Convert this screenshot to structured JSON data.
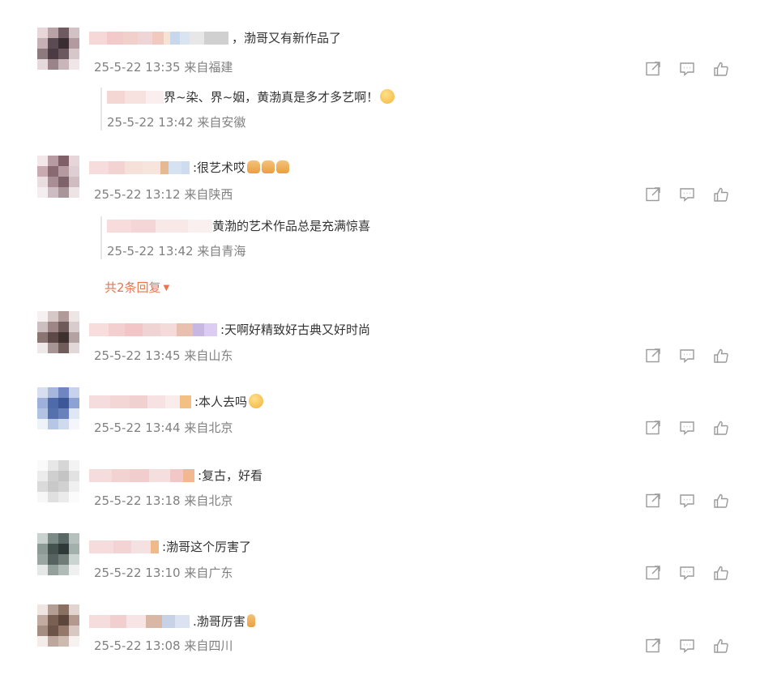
{
  "comments": [
    {
      "nick_colors": [
        "#f6d8d8",
        "#f4c9c9",
        "#f1d0cc",
        "#efd5d5",
        "#f2c9bf",
        "#f7e3d3",
        "#c9d7ec",
        "#d9e4f3",
        "#e7e7e7",
        "#d0d0d0"
      ],
      "text": "，渤哥又有新作品了",
      "time": "25-5-22 13:35",
      "location": "来自福建",
      "avatar": [
        "#e9d6d9",
        "#b8a2a6",
        "#6e5a60",
        "#d2c2c5",
        "#c7b0b5",
        "#5b4a52",
        "#3a2e33",
        "#b29aa0",
        "#8d7a7f",
        "#4a3c42",
        "#6b585e",
        "#d7c6ca",
        "#e5d9dc",
        "#9a8489",
        "#c9b6bb",
        "#f0e6e8"
      ],
      "reply": {
        "nick_colors": [
          "#f4d6d3",
          "#f7e2df",
          "#fbeeee"
        ],
        "text": "界~染、界~姻，黄渤真是多才多艺啊！",
        "emoji_color": "#f4b63c",
        "time": "25-5-22 13:42",
        "location": "来自安徽"
      }
    },
    {
      "nick_colors": [
        "#f6dcdc",
        "#f3d2d2",
        "#f5e0da",
        "#f7e5dd",
        "#e7b990",
        "#d6e2f1",
        "#cddcf0"
      ],
      "text": ":很艺术哎",
      "time": "25-5-22 13:12",
      "location": "来自陕西",
      "avatar": [
        "#f3e7ea",
        "#b89aa2",
        "#7f6068",
        "#e6d6da",
        "#c9aab1",
        "#8a6a72",
        "#b69aa1",
        "#ddcfd3",
        "#e9dde0",
        "#a98e95",
        "#7d6269",
        "#d0bcc1",
        "#f5eef0",
        "#cdbcc1",
        "#a9969b",
        "#eee4e6"
      ],
      "reply": {
        "nick_colors": [
          "#f8dcdc",
          "#f5d6d6",
          "#f9e8e8",
          "#fbf0f0"
        ],
        "text": "黄渤的艺术作品总是充满惊喜",
        "time": "25-5-22 13:42",
        "location": "来自青海"
      },
      "more_label": "共2条回复"
    },
    {
      "nick_colors": [
        "#f7dedd",
        "#f4cfcf",
        "#f2c6c6",
        "#f0d3d3",
        "#f5dada",
        "#e9c0b0",
        "#c8b6e3",
        "#dccbf3"
      ],
      "text": ":天啊好精致好古典又好时尚",
      "time": "25-5-22 13:45",
      "location": "来自山东",
      "avatar": [
        "#f6f0f0",
        "#d7c8c8",
        "#b09a9a",
        "#eee5e5",
        "#cdbfbf",
        "#9e8686",
        "#6f5a5a",
        "#d9cccc",
        "#8b7474",
        "#5e4949",
        "#3f3030",
        "#b4a2a2",
        "#efe8e8",
        "#a79494",
        "#715c5c",
        "#e3d8d8"
      ]
    },
    {
      "nick_colors": [
        "#f6dddd",
        "#f3d6d6",
        "#f1d0d0",
        "#f6e2e2",
        "#fbecec",
        "#f2c083"
      ],
      "text": ":本人去吗",
      "emoji_color": "#f3b23b",
      "time": "25-5-22 13:44",
      "location": "来自北京",
      "avatar": [
        "#d7def0",
        "#a7b6dc",
        "#6f86c0",
        "#c7d2ec",
        "#9cb0da",
        "#4f6aa8",
        "#3c5696",
        "#8ca2d2",
        "#b2c2e3",
        "#5470ad",
        "#6a82bc",
        "#dfe6f4",
        "#eef2f9",
        "#b8c6e6",
        "#d0daef",
        "#f4f6fb"
      ]
    },
    {
      "nick_colors": [
        "#f6dddd",
        "#f3d2d2",
        "#f1cdcd",
        "#f5dede",
        "#f2c7c7",
        "#f0b98f"
      ],
      "text": ":复古，好看",
      "time": "25-5-22 13:18",
      "location": "来自北京",
      "avatar": [
        "#fafafa",
        "#e7e7e7",
        "#d6d6d6",
        "#f3f3f3",
        "#ececec",
        "#cfcfcf",
        "#c4c4c4",
        "#e2e2e2",
        "#dadada",
        "#c9c9c9",
        "#d1d1d1",
        "#f0f0f0",
        "#f7f7f7",
        "#e0e0e0",
        "#ebebeb",
        "#fbfbfb"
      ]
    },
    {
      "nick_colors": [
        "#f6dcdc",
        "#f3d3d3",
        "#f5e1e1",
        "#f0b98a"
      ],
      "text": ":渤哥这个厉害了",
      "time": "25-5-22 13:10",
      "location": "来自广东",
      "avatar": [
        "#c9d2cf",
        "#7b8a86",
        "#5a6865",
        "#b6c0bd",
        "#8d9b97",
        "#46524f",
        "#2f3937",
        "#a4b0ac",
        "#9aa6a2",
        "#55625f",
        "#6f7c78",
        "#ccd4d1",
        "#e4e9e7",
        "#94a09c",
        "#b1bbb8",
        "#eef1f0"
      ]
    },
    {
      "nick_colors": [
        "#f6dddd",
        "#f2cfcf",
        "#f7e4e4",
        "#d8b7a6",
        "#c7d2e6",
        "#dbe3f2"
      ],
      "text": ".渤哥厉害",
      "time": "25-5-22 13:08",
      "location": "来自四川",
      "avatar": [
        "#efe6e2",
        "#b39e94",
        "#8a6f63",
        "#e2d4ce",
        "#c2aba0",
        "#7a5f53",
        "#5c463c",
        "#b49a8e",
        "#a58d82",
        "#6d5448",
        "#94786b",
        "#d8c8c1",
        "#f3ece9",
        "#bda79d",
        "#cdbab1",
        "#f7f1ef"
      ]
    }
  ],
  "icons": {
    "share": "share-icon",
    "comment": "comment-icon",
    "like": "like-icon"
  }
}
